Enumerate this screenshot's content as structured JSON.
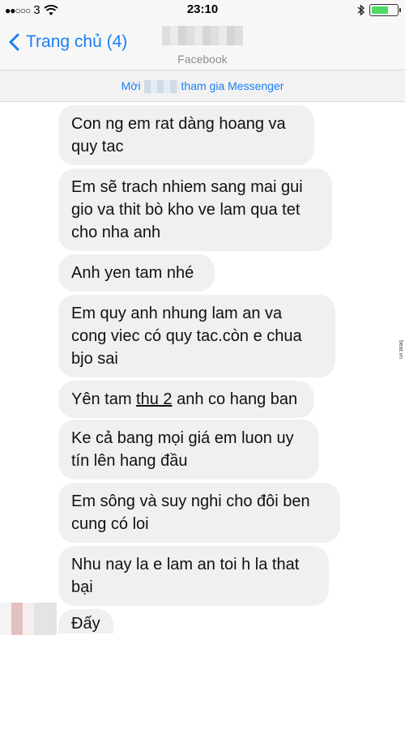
{
  "status_bar": {
    "signal_dots": "●●○○○",
    "carrier": "3",
    "time": "23:10"
  },
  "nav": {
    "back_label": "Trang chủ (4)",
    "subtitle": "Facebook"
  },
  "invite": {
    "prefix": "Mời",
    "suffix": "tham gia Messenger"
  },
  "messages": [
    {
      "lines": [
        "Con ng em rat dàng hoang va",
        "quy tac"
      ]
    },
    {
      "lines": [
        "Em sẽ trach nhiem sang mai gui",
        "gio va thit bò kho ve lam qua tet",
        "cho nha anh"
      ]
    },
    {
      "lines": [
        "Anh yen tam nhé"
      ]
    },
    {
      "lines": [
        "Em quy anh nhung lam an va",
        "cong viec có quy tac.còn e chua",
        "bjo sai"
      ]
    },
    {
      "before": "Yên tam ",
      "underlined": "thu 2",
      "after": " anh co hang ban"
    },
    {
      "lines": [
        "Ke cả bang mọi giá em luon uy",
        "tín lên hang đầu"
      ]
    },
    {
      "lines": [
        "Em sông và suy nghi cho đôi ben",
        "cung có loi"
      ]
    },
    {
      "lines": [
        "Nhu nay la e lam an toi h la that",
        "bại"
      ]
    },
    {
      "lines": [
        "Đấy"
      ]
    }
  ],
  "watermark": "beat.vn",
  "colors": {
    "accent": "#1a7ef5",
    "bubble": "#f0f0f0",
    "bar_bg": "#f7f7f7",
    "battery": "#4cd964"
  }
}
